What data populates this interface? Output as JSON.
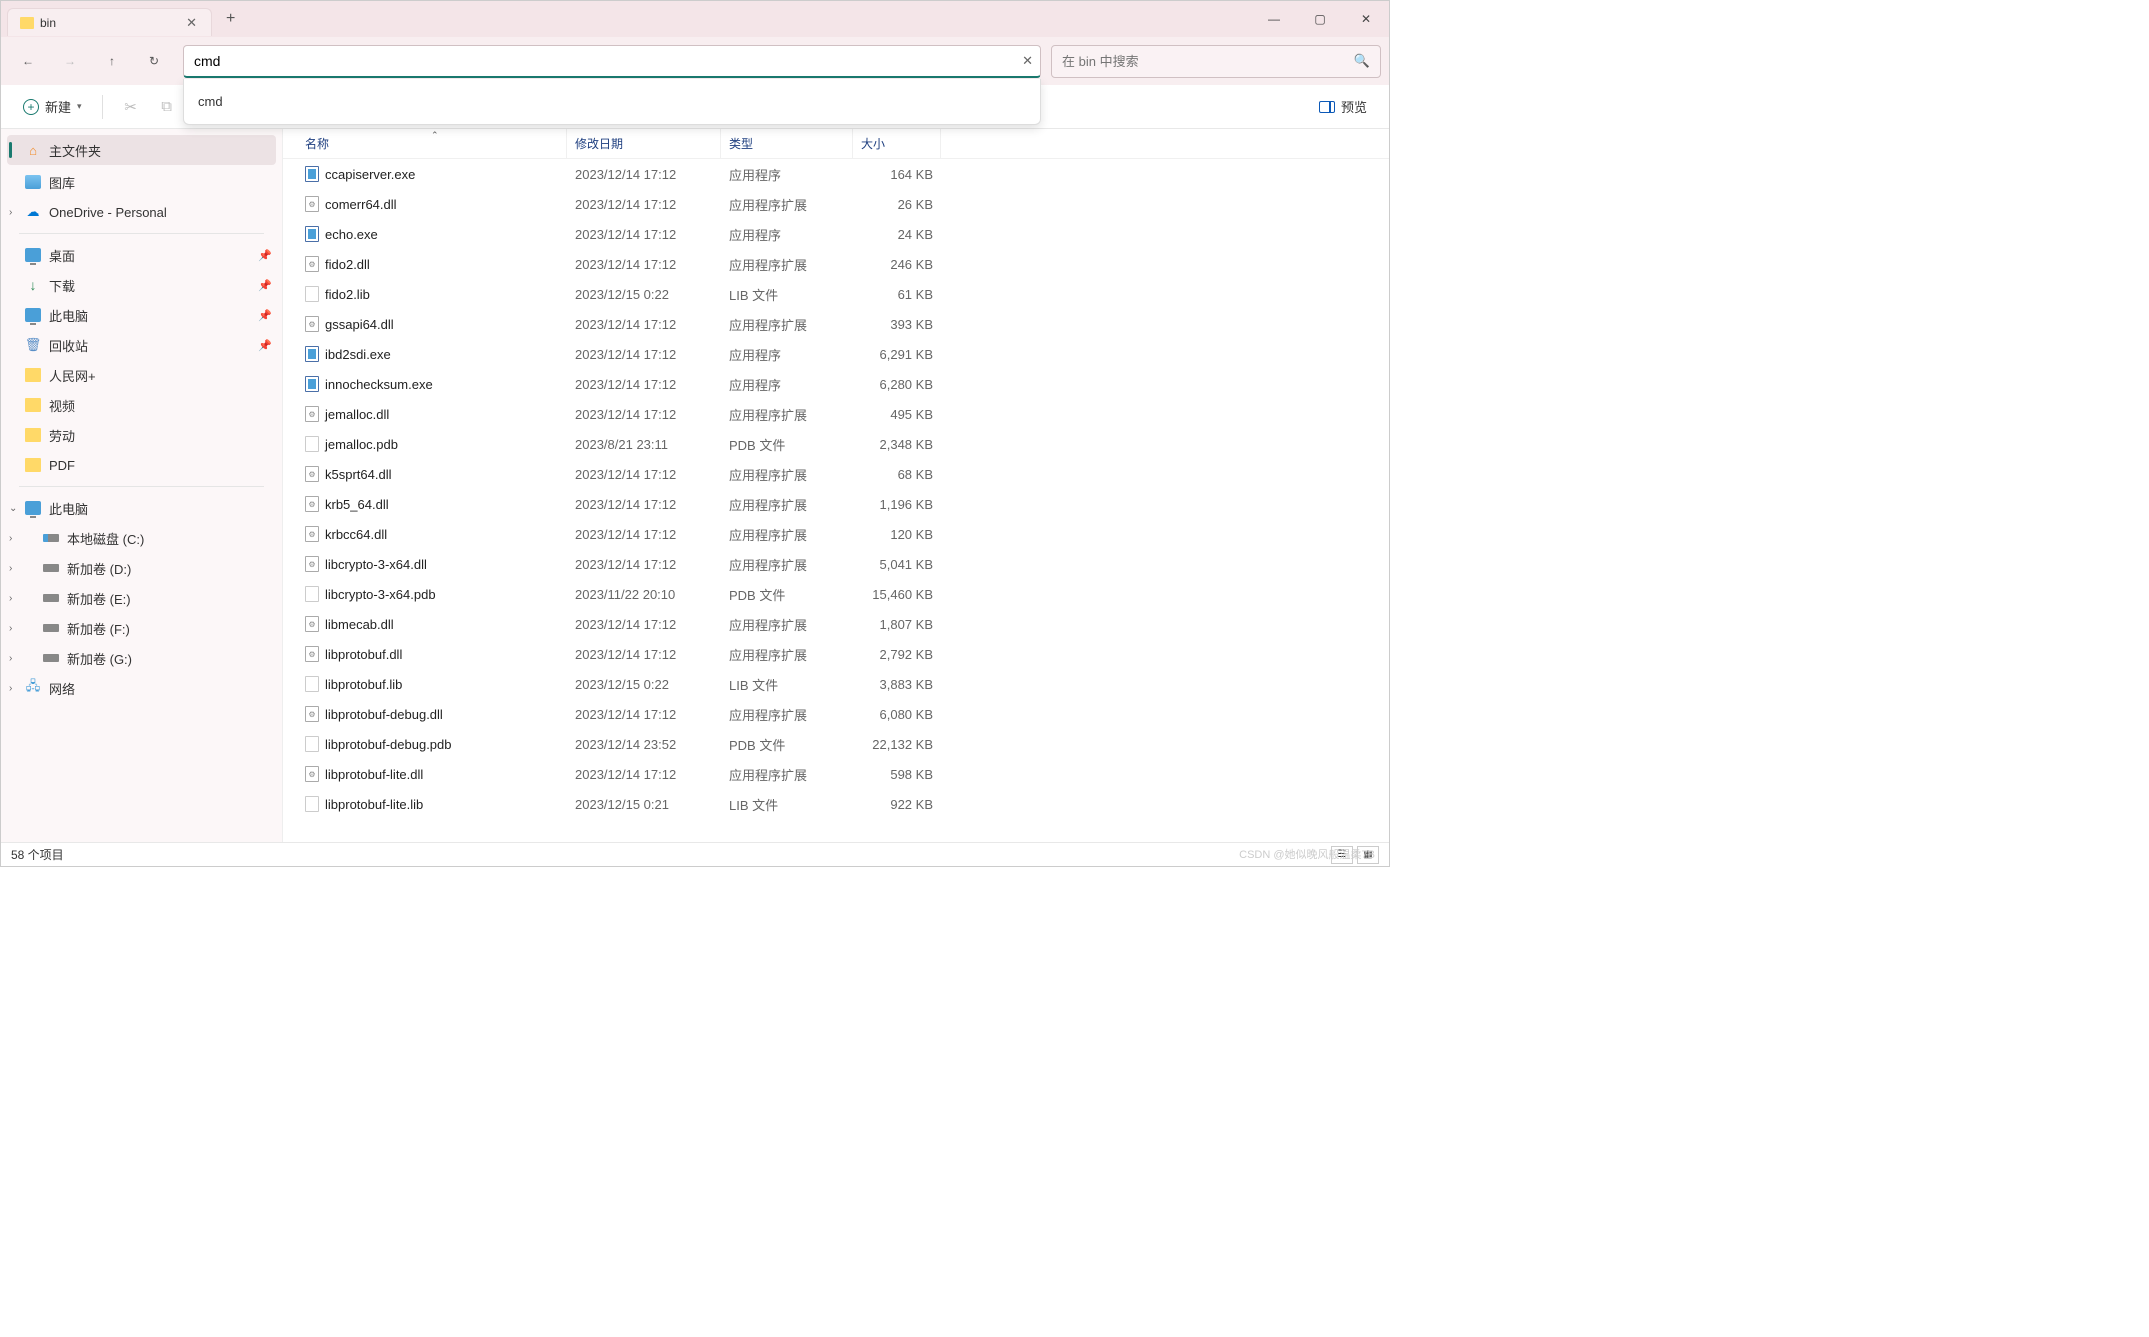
{
  "tab": {
    "title": "bin"
  },
  "address": {
    "value": "cmd",
    "suggestion": "cmd"
  },
  "search": {
    "placeholder": "在 bin 中搜索"
  },
  "toolbar": {
    "new_label": "新建",
    "preview_label": "预览"
  },
  "sidebar": {
    "home": "主文件夹",
    "gallery": "图库",
    "onedrive": "OneDrive - Personal",
    "quick": {
      "desktop": "桌面",
      "downloads": "下载",
      "thispc": "此电脑",
      "recycle": "回收站",
      "folder1": "人民网+",
      "folder2": "视频",
      "folder3": "劳动",
      "folder4": "PDF"
    },
    "thispc_label": "此电脑",
    "drives": {
      "c": "本地磁盘 (C:)",
      "d": "新加卷 (D:)",
      "e": "新加卷 (E:)",
      "f": "新加卷 (F:)",
      "g": "新加卷 (G:)"
    },
    "network": "网络"
  },
  "columns": {
    "name": "名称",
    "date": "修改日期",
    "type": "类型",
    "size": "大小"
  },
  "types": {
    "exe": "应用程序",
    "dll": "应用程序扩展",
    "lib": "LIB 文件",
    "pdb": "PDB 文件"
  },
  "files": [
    {
      "name": "ccapiserver.exe",
      "date": "2023/12/14 17:12",
      "typeKey": "exe",
      "size": "164 KB",
      "ico": "exe"
    },
    {
      "name": "comerr64.dll",
      "date": "2023/12/14 17:12",
      "typeKey": "dll",
      "size": "26 KB",
      "ico": "dll"
    },
    {
      "name": "echo.exe",
      "date": "2023/12/14 17:12",
      "typeKey": "exe",
      "size": "24 KB",
      "ico": "exe"
    },
    {
      "name": "fido2.dll",
      "date": "2023/12/14 17:12",
      "typeKey": "dll",
      "size": "246 KB",
      "ico": "dll"
    },
    {
      "name": "fido2.lib",
      "date": "2023/12/15 0:22",
      "typeKey": "lib",
      "size": "61 KB",
      "ico": "doc"
    },
    {
      "name": "gssapi64.dll",
      "date": "2023/12/14 17:12",
      "typeKey": "dll",
      "size": "393 KB",
      "ico": "dll"
    },
    {
      "name": "ibd2sdi.exe",
      "date": "2023/12/14 17:12",
      "typeKey": "exe",
      "size": "6,291 KB",
      "ico": "exe"
    },
    {
      "name": "innochecksum.exe",
      "date": "2023/12/14 17:12",
      "typeKey": "exe",
      "size": "6,280 KB",
      "ico": "exe"
    },
    {
      "name": "jemalloc.dll",
      "date": "2023/12/14 17:12",
      "typeKey": "dll",
      "size": "495 KB",
      "ico": "dll"
    },
    {
      "name": "jemalloc.pdb",
      "date": "2023/8/21 23:11",
      "typeKey": "pdb",
      "size": "2,348 KB",
      "ico": "doc"
    },
    {
      "name": "k5sprt64.dll",
      "date": "2023/12/14 17:12",
      "typeKey": "dll",
      "size": "68 KB",
      "ico": "dll"
    },
    {
      "name": "krb5_64.dll",
      "date": "2023/12/14 17:12",
      "typeKey": "dll",
      "size": "1,196 KB",
      "ico": "dll"
    },
    {
      "name": "krbcc64.dll",
      "date": "2023/12/14 17:12",
      "typeKey": "dll",
      "size": "120 KB",
      "ico": "dll"
    },
    {
      "name": "libcrypto-3-x64.dll",
      "date": "2023/12/14 17:12",
      "typeKey": "dll",
      "size": "5,041 KB",
      "ico": "dll"
    },
    {
      "name": "libcrypto-3-x64.pdb",
      "date": "2023/11/22 20:10",
      "typeKey": "pdb",
      "size": "15,460 KB",
      "ico": "doc"
    },
    {
      "name": "libmecab.dll",
      "date": "2023/12/14 17:12",
      "typeKey": "dll",
      "size": "1,807 KB",
      "ico": "dll"
    },
    {
      "name": "libprotobuf.dll",
      "date": "2023/12/14 17:12",
      "typeKey": "dll",
      "size": "2,792 KB",
      "ico": "dll"
    },
    {
      "name": "libprotobuf.lib",
      "date": "2023/12/15 0:22",
      "typeKey": "lib",
      "size": "3,883 KB",
      "ico": "doc"
    },
    {
      "name": "libprotobuf-debug.dll",
      "date": "2023/12/14 17:12",
      "typeKey": "dll",
      "size": "6,080 KB",
      "ico": "dll"
    },
    {
      "name": "libprotobuf-debug.pdb",
      "date": "2023/12/14 23:52",
      "typeKey": "pdb",
      "size": "22,132 KB",
      "ico": "doc"
    },
    {
      "name": "libprotobuf-lite.dll",
      "date": "2023/12/14 17:12",
      "typeKey": "dll",
      "size": "598 KB",
      "ico": "dll"
    },
    {
      "name": "libprotobuf-lite.lib",
      "date": "2023/12/15 0:21",
      "typeKey": "lib",
      "size": "922 KB",
      "ico": "doc"
    }
  ],
  "status": {
    "count": "58 个项目"
  },
  "watermark": "CSDN @她似晚风般温柔7B"
}
